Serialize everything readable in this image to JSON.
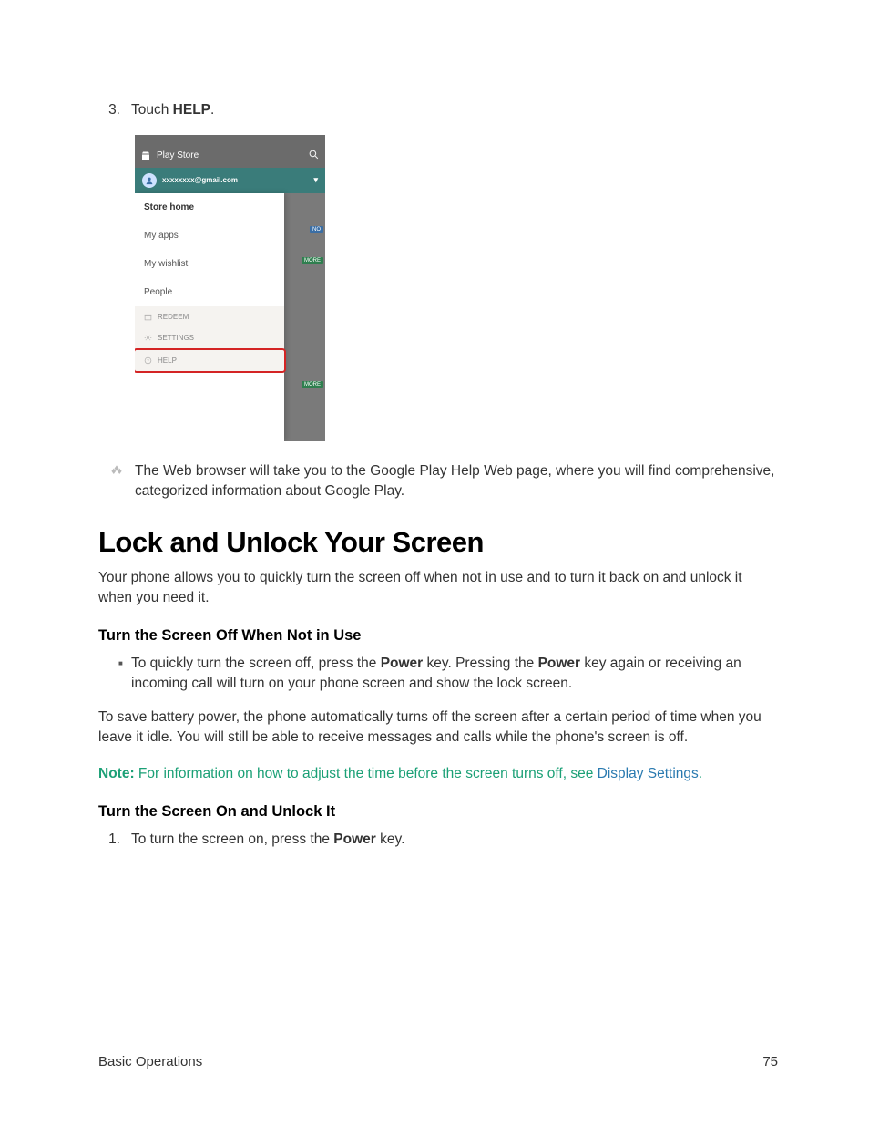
{
  "step3": {
    "num": "3.",
    "pre": "Touch ",
    "bold": "HELP",
    "post": "."
  },
  "phone": {
    "title": "Play Store",
    "email": "xxxxxxxx@gmail.com",
    "items": [
      "Store home",
      "My apps",
      "My wishlist",
      "People"
    ],
    "small": [
      "REDEEM",
      "SETTINGS",
      "HELP"
    ],
    "badges": {
      "no": "NO",
      "more1": "MORE",
      "more2": "MORE"
    }
  },
  "diamond": "The Web browser will take you to the Google Play Help Web page, where you will find comprehensive, categorized information about Google Play.",
  "h1": "Lock and Unlock Your Screen",
  "intro": "Your phone allows you to quickly turn the screen off when not in use and to turn it back on and unlock it when you need it.",
  "sub1": "Turn the Screen Off When Not in Use",
  "bullet1": {
    "a": "To quickly turn the screen off, press the ",
    "b1": "Power",
    "c": " key. Pressing the ",
    "b2": "Power",
    "d": " key again or receiving an incoming call will turn on your phone screen and show the lock screen."
  },
  "para2": "To save battery power, the phone automatically turns off the screen after a certain period of time when you leave it idle. You will still be able to receive messages and calls while the phone's screen is off.",
  "note": {
    "label": "Note:",
    "text": " For information on how to adjust the time before the screen turns off, see ",
    "link": "Display Settings",
    "after": "."
  },
  "sub2": "Turn the Screen On and Unlock It",
  "ol1": {
    "num": "1.",
    "a": "To turn the screen on, press the ",
    "b": "Power",
    "c": " key."
  },
  "footer": {
    "left": "Basic Operations",
    "right": "75"
  }
}
